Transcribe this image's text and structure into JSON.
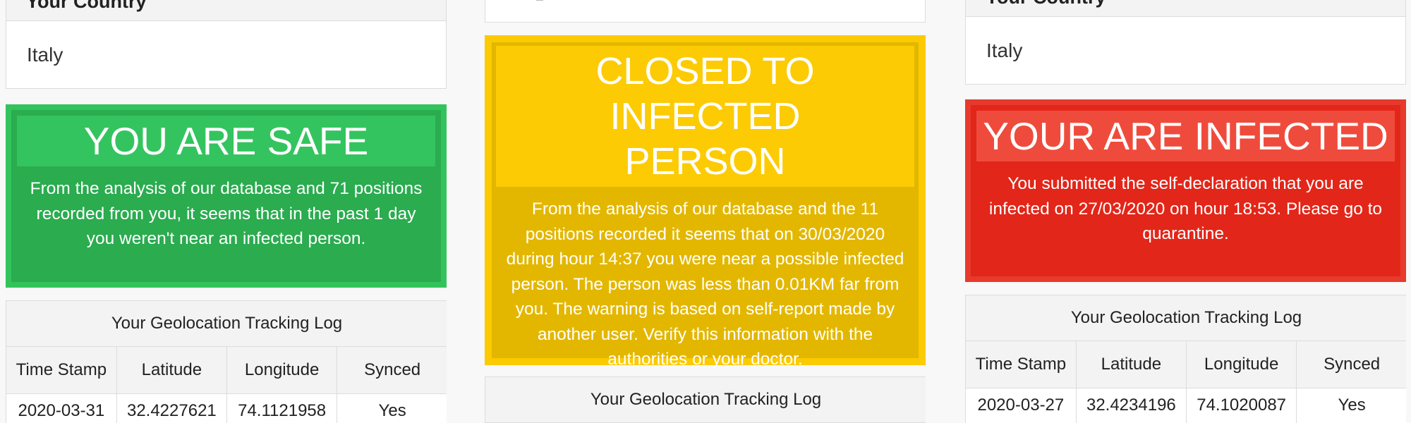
{
  "panels": [
    {
      "country_header": "Your Country",
      "country_value": "Italy",
      "status_title": "YOU ARE SAFE",
      "status_message": "From the analysis of our database and 71 positions recorded from you, it seems that in the past 1 day you weren't near an infected person.",
      "status_color": "#2aac4f",
      "log_title": "Your Geolocation Tracking Log",
      "log_columns": [
        "Time Stamp",
        "Latitude",
        "Longitude",
        "Synced"
      ],
      "log_rows": [
        [
          "2020-03-31",
          "32.4227621",
          "74.1121958",
          "Yes"
        ]
      ]
    },
    {
      "status_title_line1": "CLOSED TO INFECTED",
      "status_title_line2": "PERSON",
      "status_message": "From the analysis of our database and the 11 positions recorded it seems that on 30/03/2020 during hour 14:37 you were near a possible infected person. The person was less than 0.01KM far from you. The warning is based on self-report made by another user. Verify this information with the authorities or your doctor.",
      "status_color": "#e3b700",
      "log_title": "Your Geolocation Tracking Log"
    },
    {
      "country_header": "Your Country",
      "country_value": "Italy",
      "status_title": "YOUR ARE INFECTED",
      "status_message": "You submitted the self-declaration that you are infected on 27/03/2020 on hour 18:53. Please go to quarantine.",
      "status_color": "#e22619",
      "log_title": "Your Geolocation Tracking Log",
      "log_columns": [
        "Time Stamp",
        "Latitude",
        "Longitude",
        "Synced"
      ],
      "log_rows": [
        [
          "2020-03-27",
          "32.4234196",
          "74.1020087",
          "Yes"
        ]
      ]
    }
  ]
}
